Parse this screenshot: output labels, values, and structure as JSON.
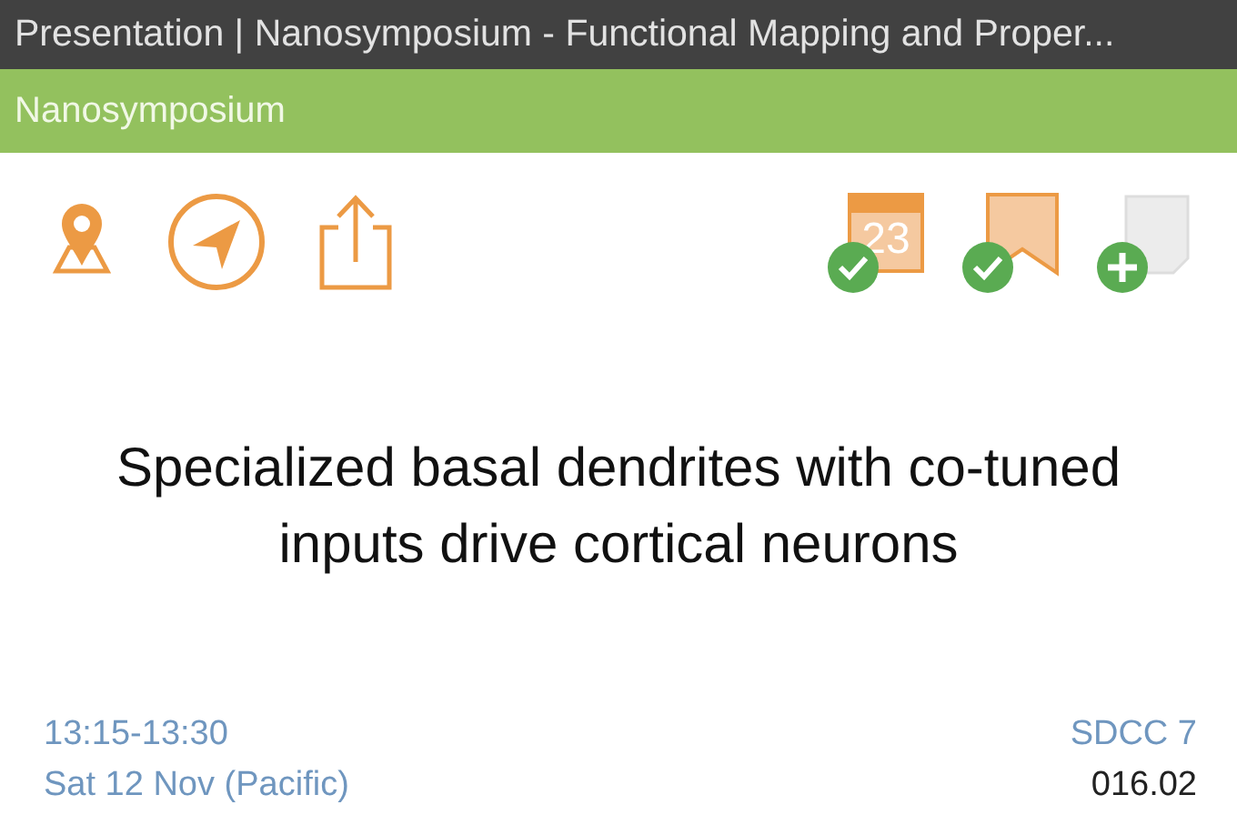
{
  "window": {
    "title": "Presentation | Nanosymposium - Functional Mapping and Proper..."
  },
  "section": {
    "title": "Nanosymposium"
  },
  "left_actions": [
    {
      "kind": "map"
    },
    {
      "kind": "navigate"
    },
    {
      "kind": "share"
    }
  ],
  "right_actions": [
    {
      "kind": "calendar",
      "day": "23",
      "added": true
    },
    {
      "kind": "bookmark",
      "added": true
    },
    {
      "kind": "note",
      "added": false
    }
  ],
  "presentation": {
    "title": "Specialized basal dendrites with co-tuned inputs drive cortical neurons",
    "time": "13:15-13:30",
    "date": "Sat 12 Nov (Pacific)",
    "room": "SDCC 7",
    "number": "016.02"
  }
}
